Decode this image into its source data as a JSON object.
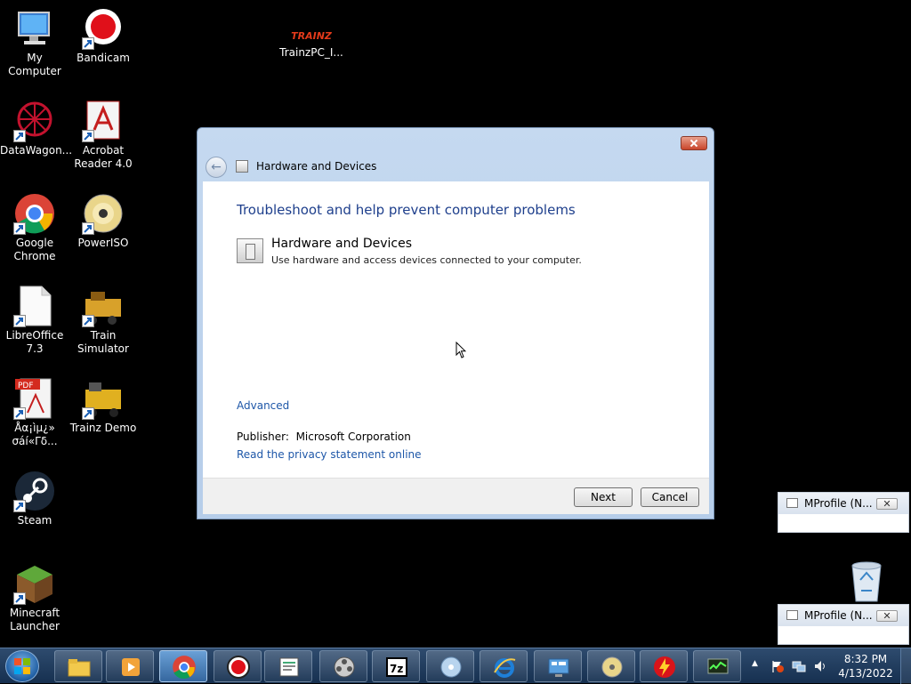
{
  "desktop": {
    "icons": [
      {
        "id": "my-computer",
        "label": "My Computer"
      },
      {
        "id": "bandicam",
        "label": "Bandicam"
      },
      {
        "id": "trainz-pc",
        "label": "TrainzPC_I..."
      },
      {
        "id": "datawagon",
        "label": "DataWagon..."
      },
      {
        "id": "acrobat",
        "label": "Acrobat\nReader 4.0"
      },
      {
        "id": "chrome",
        "label": "Google\nChrome"
      },
      {
        "id": "poweriso",
        "label": "PowerISO"
      },
      {
        "id": "libreoffice",
        "label": "LibreOffice\n7.3"
      },
      {
        "id": "train-sim",
        "label": "Train\nSimulator"
      },
      {
        "id": "pdf-file",
        "label": "Åα¡ìμ¿»\nσáí«Γδ..."
      },
      {
        "id": "trainz-demo",
        "label": "Trainz Demo"
      },
      {
        "id": "steam",
        "label": "Steam"
      },
      {
        "id": "minecraft",
        "label": "Minecraft\nLauncher"
      }
    ],
    "trainz_logo_text": "TRAINZ"
  },
  "dialog": {
    "title": "Hardware and Devices",
    "heading": "Troubleshoot and help prevent computer problems",
    "item_title": "Hardware and Devices",
    "item_description": "Use hardware and access devices connected to your computer.",
    "advanced_link": "Advanced",
    "publisher_label": "Publisher:",
    "publisher_value": "Microsoft Corporation",
    "privacy_link": "Read the privacy statement online",
    "next_button": "Next",
    "cancel_button": "Cancel"
  },
  "notifications": [
    {
      "title": "MProfile (N..."
    },
    {
      "title": "MProfile (N..."
    }
  ],
  "taskbar": {
    "clock_time": "8:32 PM",
    "clock_date": "4/13/2022",
    "tray_arrow": "▲"
  },
  "colors": {
    "accent_blue": "#1e3f8c",
    "link_blue": "#1e57a8",
    "taskbar": "#1d3a5e",
    "window_frame": "#bcd2ec"
  }
}
